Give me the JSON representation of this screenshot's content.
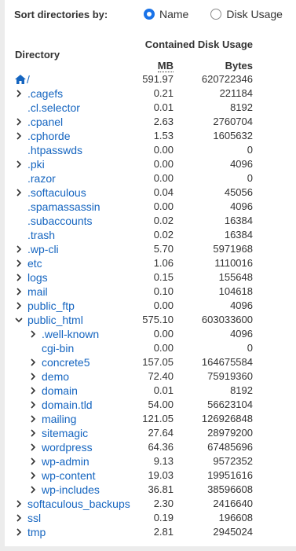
{
  "sort": {
    "label": "Sort directories by:",
    "options": [
      {
        "label": "Name",
        "checked": true
      },
      {
        "label": "Disk Usage",
        "checked": false
      }
    ]
  },
  "table": {
    "directory_header": "Directory",
    "contained_header": "Contained Disk Usage",
    "mb_header": "MB",
    "bytes_header": "Bytes",
    "accent_color": "#1565c0",
    "rows": [
      {
        "name": "/",
        "icon": "home-icon",
        "mb": "591.97",
        "bytes": "620722346",
        "level": 0,
        "chevron": "none"
      },
      {
        "name": ".cagefs",
        "mb": "0.21",
        "bytes": "221184",
        "level": 0,
        "chevron": "right"
      },
      {
        "name": ".cl.selector",
        "mb": "0.01",
        "bytes": "8192",
        "level": 0,
        "chevron": "none"
      },
      {
        "name": ".cpanel",
        "mb": "2.63",
        "bytes": "2760704",
        "level": 0,
        "chevron": "right"
      },
      {
        "name": ".cphorde",
        "mb": "1.53",
        "bytes": "1605632",
        "level": 0,
        "chevron": "right"
      },
      {
        "name": ".htpasswds",
        "mb": "0.00",
        "bytes": "0",
        "level": 0,
        "chevron": "none"
      },
      {
        "name": ".pki",
        "mb": "0.00",
        "bytes": "4096",
        "level": 0,
        "chevron": "right"
      },
      {
        "name": ".razor",
        "mb": "0.00",
        "bytes": "0",
        "level": 0,
        "chevron": "none"
      },
      {
        "name": ".softaculous",
        "mb": "0.04",
        "bytes": "45056",
        "level": 0,
        "chevron": "right"
      },
      {
        "name": ".spamassassin",
        "mb": "0.00",
        "bytes": "4096",
        "level": 0,
        "chevron": "none"
      },
      {
        "name": ".subaccounts",
        "mb": "0.02",
        "bytes": "16384",
        "level": 0,
        "chevron": "none"
      },
      {
        "name": ".trash",
        "mb": "0.02",
        "bytes": "16384",
        "level": 0,
        "chevron": "none"
      },
      {
        "name": ".wp-cli",
        "mb": "5.70",
        "bytes": "5971968",
        "level": 0,
        "chevron": "right"
      },
      {
        "name": "etc",
        "mb": "1.06",
        "bytes": "1110016",
        "level": 0,
        "chevron": "right"
      },
      {
        "name": "logs",
        "mb": "0.15",
        "bytes": "155648",
        "level": 0,
        "chevron": "right"
      },
      {
        "name": "mail",
        "mb": "0.10",
        "bytes": "104618",
        "level": 0,
        "chevron": "right"
      },
      {
        "name": "public_ftp",
        "mb": "0.00",
        "bytes": "4096",
        "level": 0,
        "chevron": "right"
      },
      {
        "name": "public_html",
        "mb": "575.10",
        "bytes": "603033600",
        "level": 0,
        "chevron": "down"
      },
      {
        "name": ".well-known",
        "mb": "0.00",
        "bytes": "4096",
        "level": 1,
        "chevron": "right"
      },
      {
        "name": "cgi-bin",
        "mb": "0.00",
        "bytes": "0",
        "level": 1,
        "chevron": "none"
      },
      {
        "name": "concrete5",
        "mb": "157.05",
        "bytes": "164675584",
        "level": 1,
        "chevron": "right"
      },
      {
        "name": "demo",
        "mb": "72.40",
        "bytes": "75919360",
        "level": 1,
        "chevron": "right"
      },
      {
        "name": "domain",
        "mb": "0.01",
        "bytes": "8192",
        "level": 1,
        "chevron": "right"
      },
      {
        "name": "domain.tld",
        "mb": "54.00",
        "bytes": "56623104",
        "level": 1,
        "chevron": "right"
      },
      {
        "name": "mailing",
        "mb": "121.05",
        "bytes": "126926848",
        "level": 1,
        "chevron": "right"
      },
      {
        "name": "sitemagic",
        "mb": "27.64",
        "bytes": "28979200",
        "level": 1,
        "chevron": "right"
      },
      {
        "name": "wordpress",
        "mb": "64.36",
        "bytes": "67485696",
        "level": 1,
        "chevron": "right"
      },
      {
        "name": "wp-admin",
        "mb": "9.13",
        "bytes": "9572352",
        "level": 1,
        "chevron": "right"
      },
      {
        "name": "wp-content",
        "mb": "19.03",
        "bytes": "19951616",
        "level": 1,
        "chevron": "right"
      },
      {
        "name": "wp-includes",
        "mb": "36.81",
        "bytes": "38596608",
        "level": 1,
        "chevron": "right"
      },
      {
        "name": "softaculous_backups",
        "mb": "2.30",
        "bytes": "2416640",
        "level": 0,
        "chevron": "right"
      },
      {
        "name": "ssl",
        "mb": "0.19",
        "bytes": "196608",
        "level": 0,
        "chevron": "right"
      },
      {
        "name": "tmp",
        "mb": "2.81",
        "bytes": "2945024",
        "level": 0,
        "chevron": "right"
      }
    ]
  }
}
